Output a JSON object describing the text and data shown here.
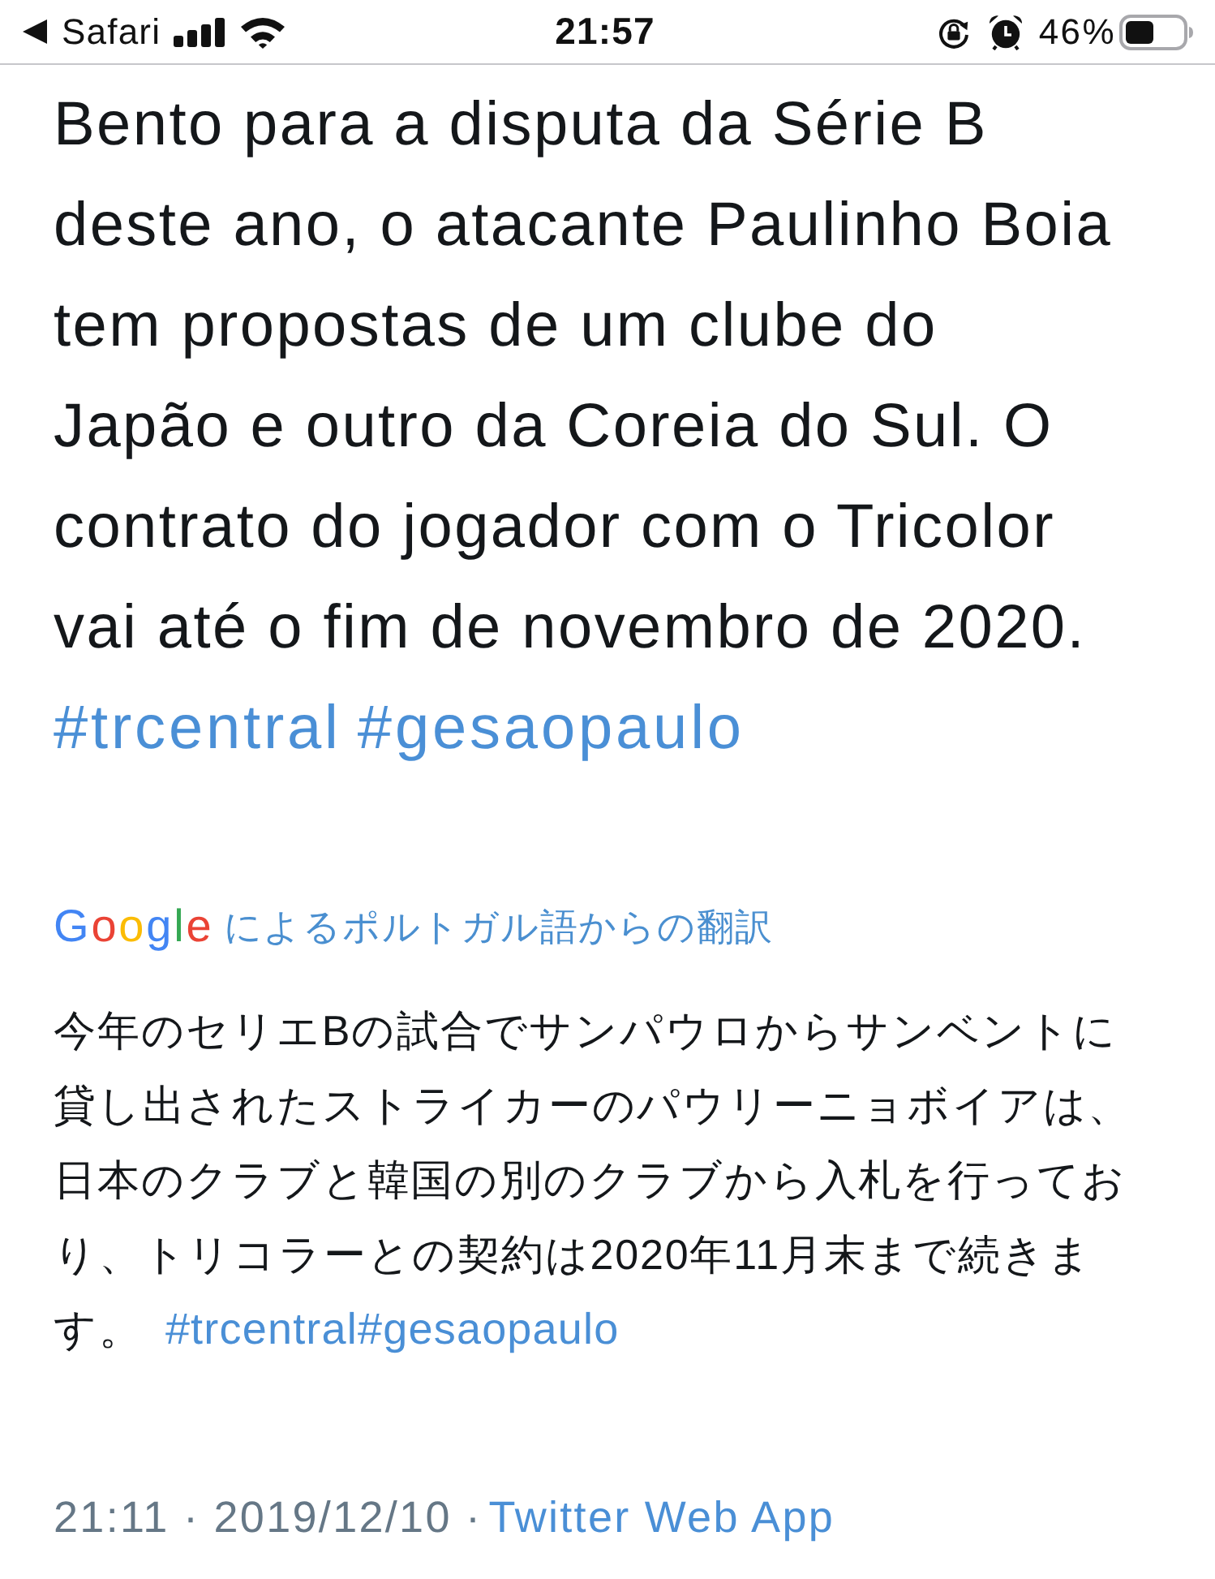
{
  "status_bar": {
    "back_label": "Safari",
    "time": "21:57",
    "battery": "46%"
  },
  "tweet": {
    "text": "Bento para a disputa da Série B deste ano, o atacante Paulinho Boia tem propostas de um clube do Japão e outro da Coreia do Sul. O contrato do jogador com o Tricolor vai até o fim de novembro de 2020.",
    "hashtags": [
      "#trcentral",
      "#gesaopaulo"
    ]
  },
  "translation": {
    "logo": "Google",
    "label": "によるポルトガル語からの翻訳",
    "text": "今年のセリエBの試合でサンパウロからサンベントに貸し出されたストライカーのパウリーニョボイアは、日本のクラブと韓国の別のクラブから入札を行っており、トリコラーとの契約は2020年11月末まで続きます。",
    "hashtags": [
      "#trcentral",
      "#gesaopaulo"
    ]
  },
  "meta": {
    "timestamp": "21:11 · 2019/12/10 ·",
    "source": "Twitter Web App"
  }
}
